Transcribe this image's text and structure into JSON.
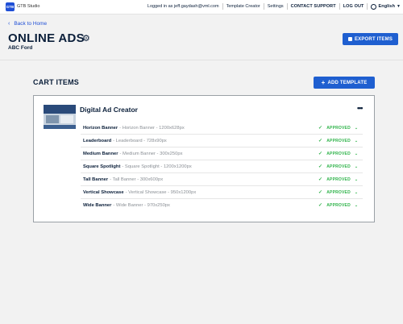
{
  "topbar": {
    "brand": "GTB Studio",
    "logo_text": "GTB",
    "logged_in": "Logged in as jeff.gaydash@vml.com",
    "template_creator": "Template Creator",
    "settings": "Settings",
    "contact_support": "CONTACT SUPPORT",
    "log_out": "LOG OUT",
    "language": "English"
  },
  "header": {
    "back_label": "Back to Home",
    "title": "ONLINE ADS",
    "subtitle": "ABC Ford",
    "export_label": "EXPORT ITEMS"
  },
  "cart": {
    "title": "CART ITEMS",
    "add_label": "ADD TEMPLATE",
    "card": {
      "title": "Digital Ad Creator",
      "items": [
        {
          "name": "Horizon Banner",
          "desc": "- Horizon Banner - 1200x628px",
          "status": "APPROVED"
        },
        {
          "name": "Leaderboard",
          "desc": "- Leaderboard - 728x90px",
          "status": "APPROVED"
        },
        {
          "name": "Medium Banner",
          "desc": "- Medium Banner - 300x250px",
          "status": "APPROVED"
        },
        {
          "name": "Square Spotlight",
          "desc": "- Square Spotlight - 1200x1200px",
          "status": "APPROVED"
        },
        {
          "name": "Tall Banner",
          "desc": "- Tall Banner - 300x600px",
          "status": "APPROVED"
        },
        {
          "name": "Vertical Showcase",
          "desc": "- Vertical Showcase - 950x1200px",
          "status": "APPROVED"
        },
        {
          "name": "Wide Banner",
          "desc": "- Wide Banner - 970x250px",
          "status": "APPROVED"
        }
      ]
    }
  },
  "colors": {
    "accent": "#1f5fd0",
    "navy": "#0b1f3a",
    "approved": "#2fb34a"
  },
  "icons": {
    "back": "chevron-left-icon",
    "settings": "gear-icon",
    "more": "more-horizontal-icon",
    "approved": "check-icon",
    "dropdown": "chevron-down-icon",
    "language": "globe-icon"
  }
}
